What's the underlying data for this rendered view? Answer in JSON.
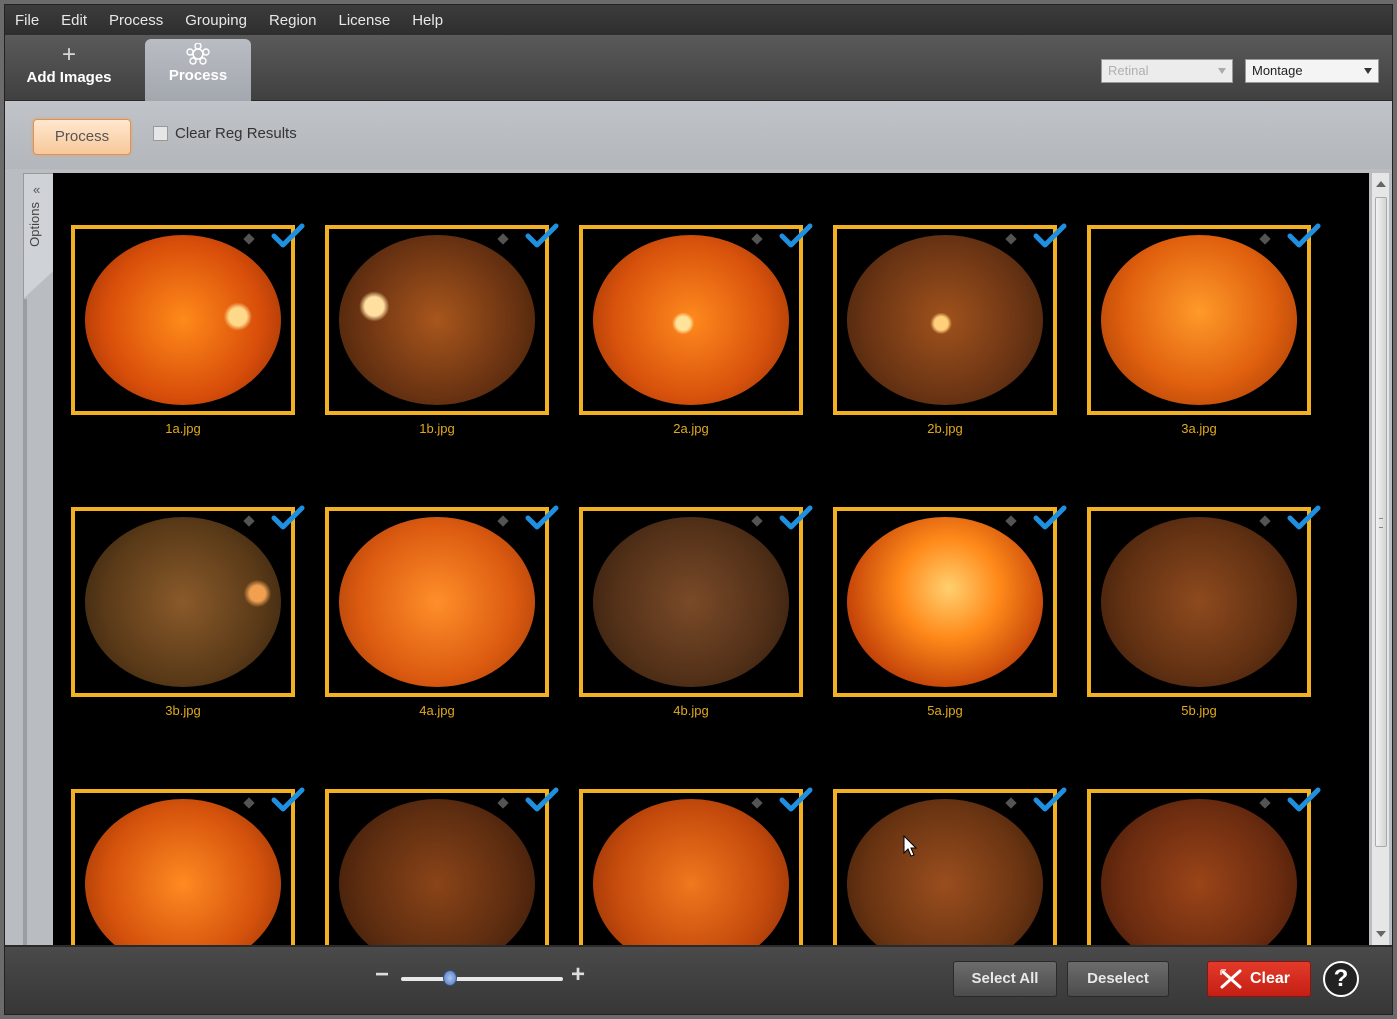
{
  "menu": [
    "File",
    "Edit",
    "Process",
    "Grouping",
    "Region",
    "License",
    "Help"
  ],
  "toolbar": {
    "add_images_label": "Add Images",
    "process_tab_label": "Process",
    "modality_select": "Retinal",
    "layout_select": "Montage"
  },
  "actionbar": {
    "process_button": "Process",
    "clear_reg_label": "Clear Reg Results"
  },
  "side_panel": {
    "label": "Options",
    "collapse_icon": "double-chevron-left-icon"
  },
  "images": [
    {
      "name": "1a.jpg",
      "selected": true
    },
    {
      "name": "1b.jpg",
      "selected": true
    },
    {
      "name": "2a.jpg",
      "selected": true
    },
    {
      "name": "2b.jpg",
      "selected": true
    },
    {
      "name": "3a.jpg",
      "selected": true
    },
    {
      "name": "3b.jpg",
      "selected": true
    },
    {
      "name": "4a.jpg",
      "selected": true
    },
    {
      "name": "4b.jpg",
      "selected": true
    },
    {
      "name": "5a.jpg",
      "selected": true
    },
    {
      "name": "5b.jpg",
      "selected": true
    },
    {
      "name": "",
      "selected": true
    },
    {
      "name": "",
      "selected": true
    },
    {
      "name": "",
      "selected": true
    },
    {
      "name": "",
      "selected": true
    },
    {
      "name": "",
      "selected": true
    }
  ],
  "bottombar": {
    "zoom_minus": "−",
    "zoom_plus": "+",
    "zoom_level": 0.3,
    "select_all_label": "Select All",
    "deselect_label": "Deselect",
    "clear_label": "Clear",
    "help_label": "?"
  },
  "colors": {
    "thumb_border": "#f2b120",
    "filename_text": "#e0a91f",
    "check_mark": "#1f8fe0",
    "clear_button": "#d42a1d"
  }
}
